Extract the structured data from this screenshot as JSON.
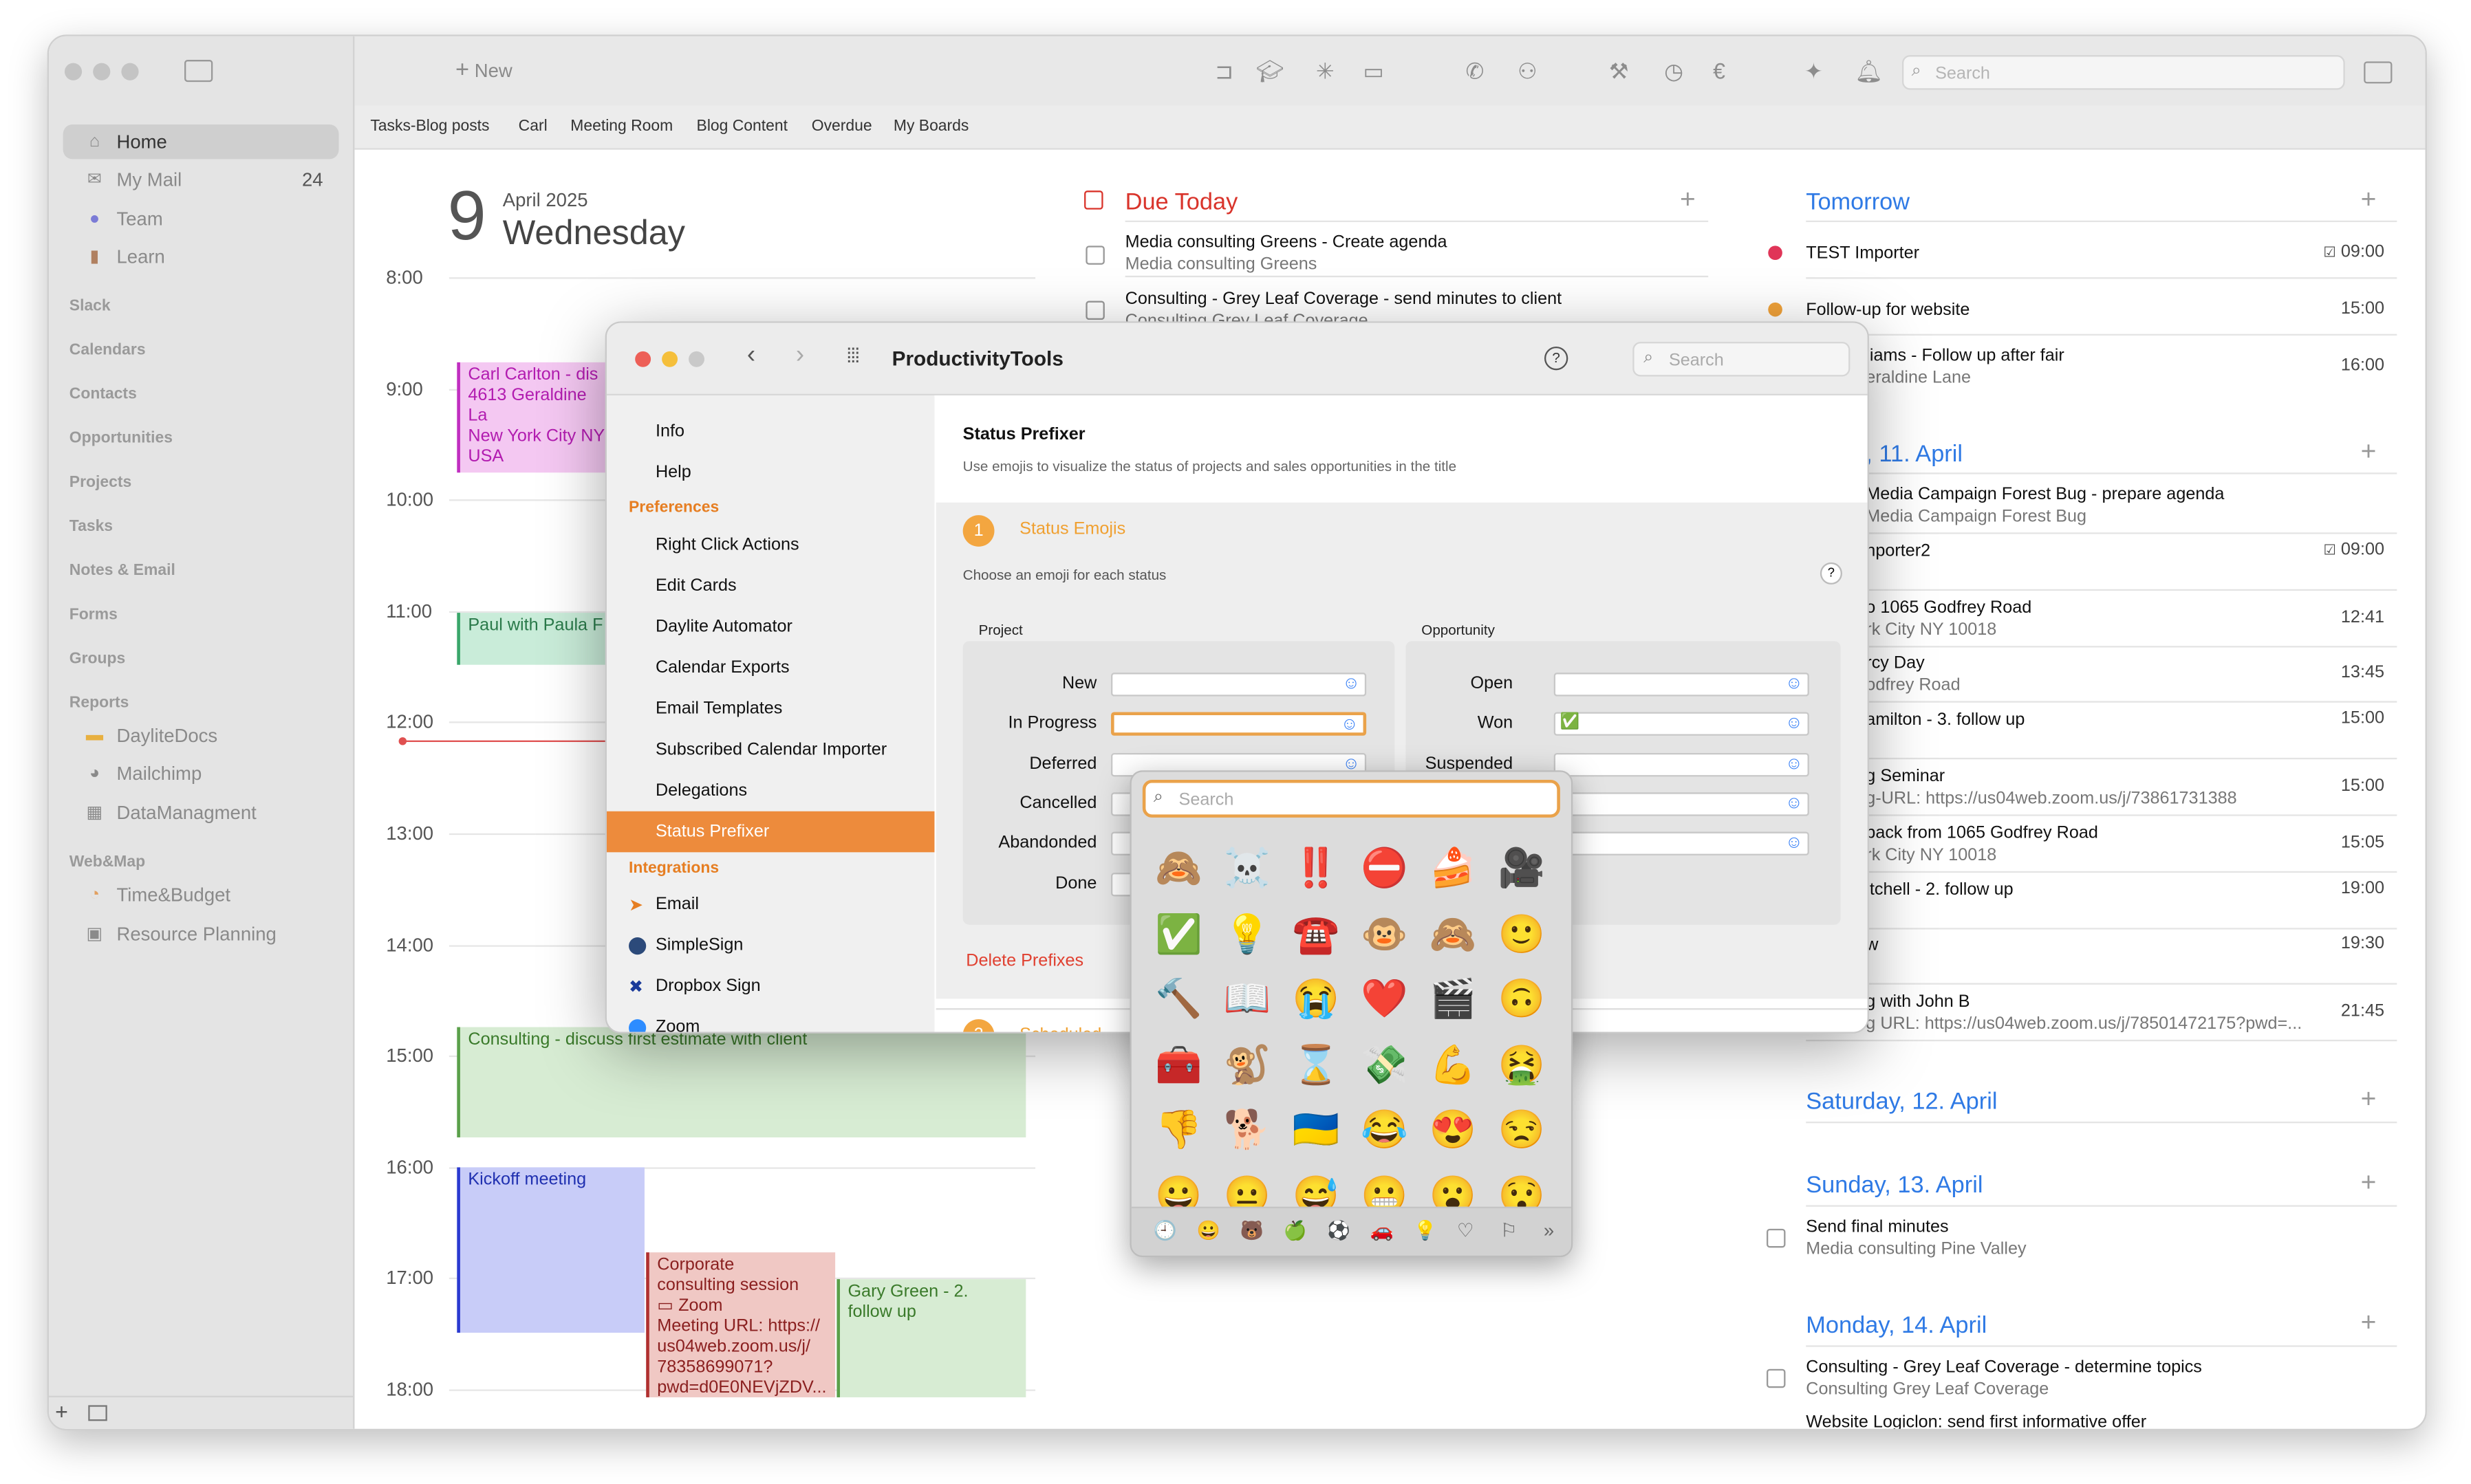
{
  "sidebar": {
    "items": [
      {
        "label": "Home",
        "icon": "home-icon"
      },
      {
        "label": "My Mail",
        "icon": "mail-icon",
        "count": "24"
      },
      {
        "label": "Team",
        "icon": "team-icon"
      },
      {
        "label": "Learn",
        "icon": "learn-icon"
      }
    ],
    "sections": [
      "Slack",
      "Calendars",
      "Contacts",
      "Opportunities",
      "Projects",
      "Tasks",
      "Notes & Email",
      "Forms",
      "Groups",
      "Reports"
    ],
    "reports": [
      "DayliteDocs",
      "Mailchimp",
      "DataManagment"
    ],
    "webmap_title": "Web&Map",
    "webmap": [
      "Time&Budget",
      "Resource Planning"
    ]
  },
  "toolbar": {
    "new_label": "New",
    "search_placeholder": "Search"
  },
  "bookmarks": [
    "Tasks-Blog posts",
    "Carl",
    "Meeting Room",
    "Blog Content",
    "Overdue",
    "My Boards"
  ],
  "calendar": {
    "day_number": "9",
    "month_year": "April 2025",
    "weekday": "Wednesday",
    "hours": [
      "8:00",
      "9:00",
      "10:00",
      "11:00",
      "12:00",
      "13:00",
      "14:00",
      "15:00",
      "16:00",
      "17:00",
      "18:00"
    ],
    "events": {
      "carl": [
        "Carl Carlton - dis",
        "4613 Geraldine La",
        "New York City  NY",
        "USA"
      ],
      "paul": "Paul with Paula F",
      "consulting": "Consulting - discuss first estimate with client",
      "kickoff": "Kickoff meeting",
      "corporate": [
        "Corporate",
        "consulting session",
        "Zoom",
        "Meeting URL: https://",
        "us04web.zoom.us/j/",
        "78358699071?",
        "pwd=d0E0NEVjZDV..."
      ],
      "gary": [
        "Gary Green - 2.",
        "follow up"
      ]
    }
  },
  "due_today": {
    "title": "Due Today",
    "tasks": [
      {
        "title": "Media consulting Greens - Create agenda",
        "sub": "Media consulting Greens"
      },
      {
        "title": "Consulting - Grey Leaf Coverage - send minutes to client",
        "sub": "Consulting Grey Leaf Coverage"
      }
    ]
  },
  "tomorrow": {
    "title": "Tomorrow",
    "items": [
      {
        "title": "TEST Importer",
        "time": "09:00"
      },
      {
        "title": "Follow-up for website",
        "time": "15:00"
      },
      {
        "title": "liams - Follow up after fair",
        "sub": "eraldine Lane",
        "time": "16:00"
      }
    ]
  },
  "friday": {
    "title": ", 11. April",
    "items": [
      {
        "title": "Media Campaign Forest Bug - prepare agenda",
        "sub": "Media Campaign Forest Bug",
        "time": ""
      },
      {
        "title": "nporter2",
        "time": "09:00"
      },
      {
        "title": "o 1065 Godfrey Road",
        "sub": "rk City  NY 10018",
        "time": "12:41"
      },
      {
        "title": "rcy Day",
        "sub": "odfrey Road",
        "time": "13:45"
      },
      {
        "title": "amilton - 3. follow up",
        "time": "15:00"
      },
      {
        "title": "g Seminar",
        "sub": "g-URL: https://us04web.zoom.us/j/73861731388",
        "time": "15:00"
      },
      {
        "title": "back from 1065 Godfrey Road",
        "sub": "rk City  NY 10018",
        "time": "15:05"
      },
      {
        "title": "itchell - 2. follow up",
        "time": "19:00"
      },
      {
        "title": "w",
        "time": "19:30"
      },
      {
        "title": "g with John B",
        "sub": "g URL: https://us04web.zoom.us/j/78501472175?pwd=...",
        "time": "21:45"
      }
    ]
  },
  "saturday": {
    "title": "Saturday, 12. April"
  },
  "sunday": {
    "title": "Sunday, 13. April",
    "task": {
      "title": "Send final minutes",
      "sub": "Media consulting Pine Valley"
    }
  },
  "monday": {
    "title": "Monday, 14. April",
    "tasks": [
      {
        "title": "Consulting - Grey Leaf Coverage - determine topics",
        "sub": "Consulting Grey Leaf Coverage"
      },
      {
        "title": "Website Logiclon: send first informative offer"
      }
    ]
  },
  "dialog": {
    "title": "ProductivityTools",
    "search_placeholder": "Search",
    "help": "?",
    "nav_top": [
      "Info",
      "Help"
    ],
    "pref_section": "Preferences",
    "prefs": [
      "Right Click Actions",
      "Edit Cards",
      "Daylite Automator",
      "Calendar Exports",
      "Email Templates",
      "Subscribed Calendar Importer",
      "Delegations",
      "Status Prefixer"
    ],
    "int_section": "Integrations",
    "integrations": [
      "Email",
      "SimpleSign",
      "Dropbox Sign",
      "Zoom"
    ],
    "heading": "Status Prefixer",
    "description": "Use emojis to visualize the status of projects and sales opportunities in the title",
    "step1_num": "1",
    "step1_title": "Status Emojis",
    "choose": "Choose an emoji for each status",
    "help2": "?",
    "project_title": "Project",
    "project_fields": [
      "New",
      "In Progress",
      "Deferred",
      "Cancelled",
      "Abandonded",
      "Done"
    ],
    "opportunity_title": "Opportunity",
    "opportunity_fields": [
      "Open",
      "Won",
      "Suspended",
      "",
      ""
    ],
    "won_value": "✅",
    "delete_label": "Delete Prefixes",
    "step2_num": "2",
    "step2_title": "Scheduled"
  },
  "picker": {
    "search_placeholder": "Search",
    "emojis": [
      "🙈",
      "☠️",
      "‼️",
      "⛔",
      "🍰",
      "🎥",
      "✅",
      "💡",
      "☎️",
      "🐵",
      "🙈",
      "🙂",
      "🔨",
      "📖",
      "😭",
      "❤️",
      "🎬",
      "🙃",
      "🧰",
      "🐒",
      "⌛",
      "💸",
      "💪",
      "🤮",
      "👎",
      "🐕",
      "🇺🇦",
      "😂",
      "😍",
      "😒",
      "😀",
      "😐",
      "😅",
      "😬",
      "😮",
      "😯"
    ],
    "categories": [
      "🕘",
      "😀",
      "🐻",
      "🍏",
      "⚽",
      "🚗",
      "💡",
      "♡",
      "⚐",
      "»"
    ]
  },
  "colors": {
    "accent_orange": "#ed8b3c",
    "due_red": "#d9342b",
    "link_blue": "#2f7ae5"
  }
}
